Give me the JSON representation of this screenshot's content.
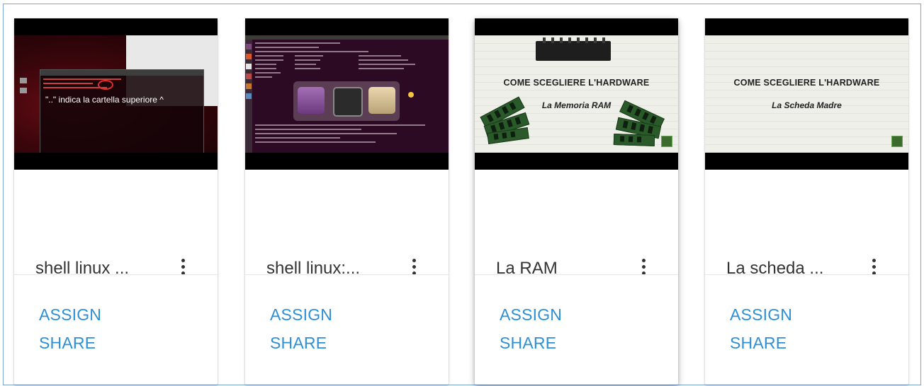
{
  "cards": [
    {
      "title": "shell linux ...",
      "thumbnail": {
        "kind": "terminal-screenshot",
        "overlay_text": "\"..\" indica la cartella superiore ^"
      },
      "actions": {
        "assign": "ASSIGN",
        "share": "SHARE"
      }
    },
    {
      "title": "shell linux:...",
      "thumbnail": {
        "kind": "terminal-screenshot"
      },
      "actions": {
        "assign": "ASSIGN",
        "share": "SHARE"
      }
    },
    {
      "title": "La RAM",
      "thumbnail": {
        "kind": "slide",
        "heading": "COME SCEGLIERE L'HARDWARE",
        "subheading": "La Memoria RAM"
      },
      "actions": {
        "assign": "ASSIGN",
        "share": "SHARE"
      }
    },
    {
      "title": "La scheda ...",
      "thumbnail": {
        "kind": "slide",
        "heading": "COME SCEGLIERE L'HARDWARE",
        "subheading": "La Scheda Madre"
      },
      "actions": {
        "assign": "ASSIGN",
        "share": "SHARE"
      }
    }
  ],
  "icons": {
    "card_menu": "more-vert-icon"
  },
  "colors": {
    "action": "#2d8fd6",
    "frame_border": "#7ea6d3"
  }
}
